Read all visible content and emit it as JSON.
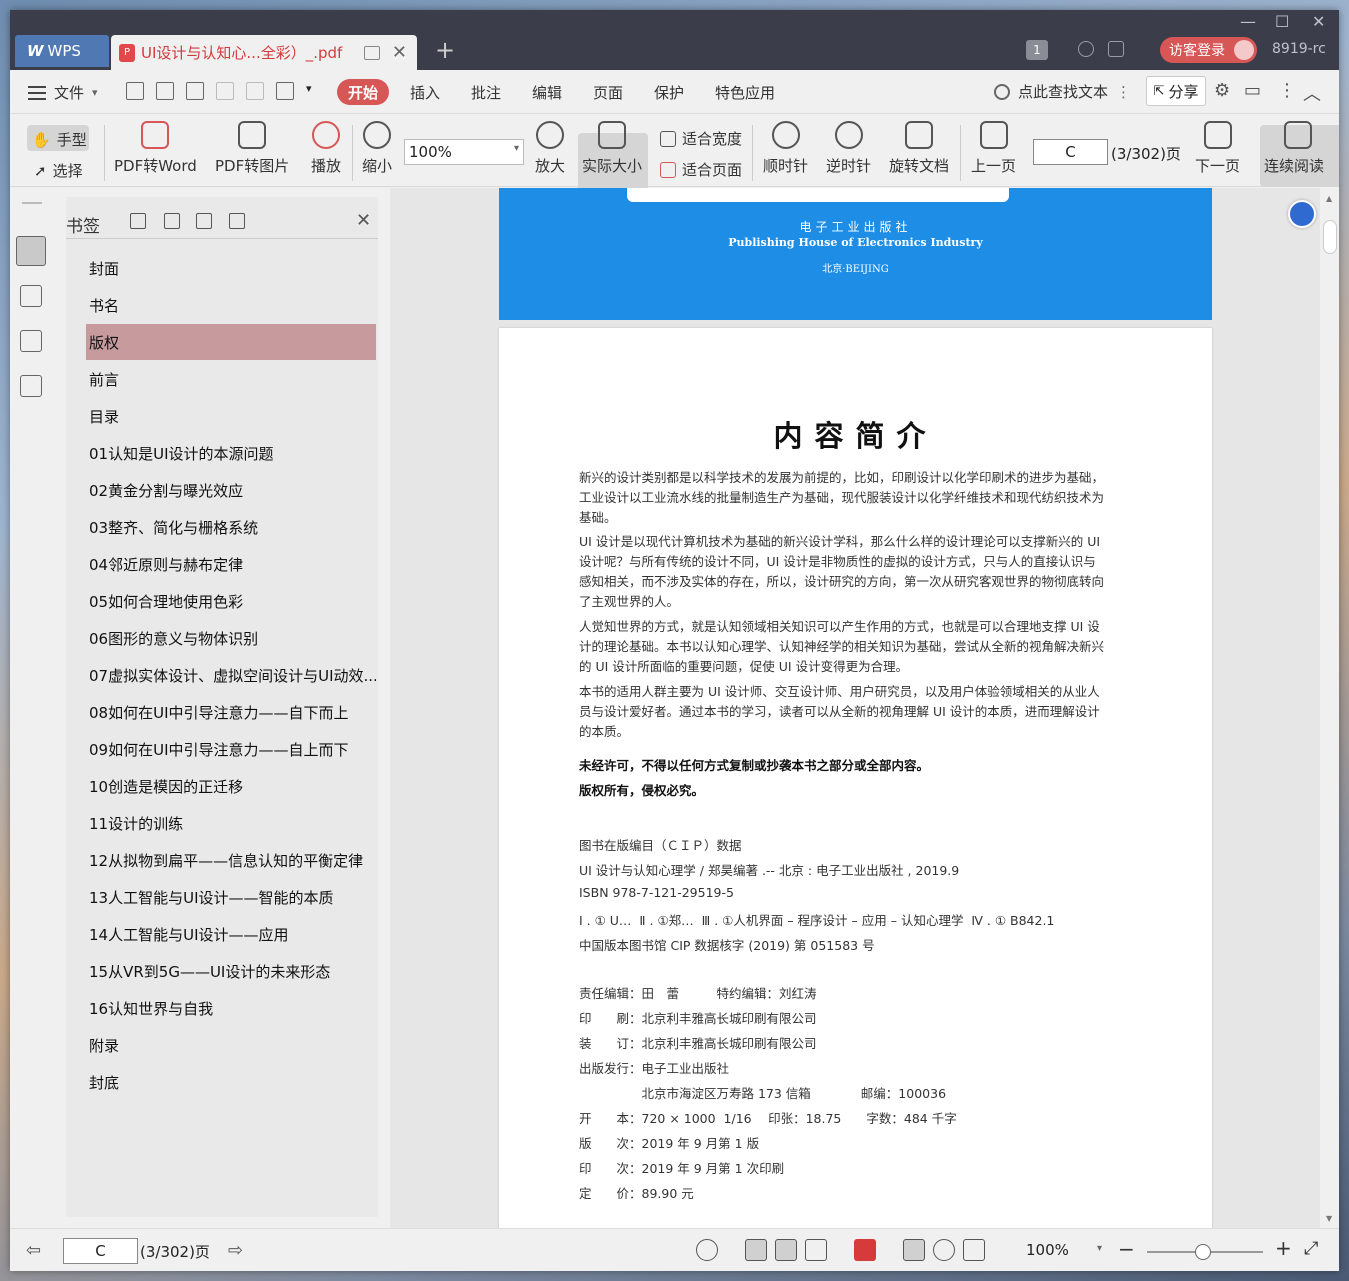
{
  "titlebar": {
    "app_tab": "WPS",
    "doc_tab": "UI设计与认知心...全彩）_.pdf",
    "badge": "1",
    "login": "访客登录",
    "user": "8919-rc",
    "win_min": "—",
    "win_max": "☐",
    "win_close": "✕"
  },
  "menubar": {
    "file": "文件",
    "tabs": [
      "开始",
      "插入",
      "批注",
      "编辑",
      "页面",
      "保护",
      "特色应用"
    ],
    "search": "点此查找文本",
    "share": "分享"
  },
  "ribbon": {
    "hand": "手型",
    "select": "选择",
    "pdf2word": "PDF转Word",
    "pdf2img": "PDF转图片",
    "play": "播放",
    "zoom_out": "缩小",
    "zoom_value": "100%",
    "zoom_in": "放大",
    "actual_size": "实际大小",
    "fit_width": "适合宽度",
    "fit_page": "适合页面",
    "clockwise": "顺时针",
    "counter_clockwise": "逆时针",
    "rotate_doc": "旋转文档",
    "prev_page": "上一页",
    "page_input": "C",
    "page_count": "(3/302)页",
    "next_page": "下一页",
    "continuous": "连续阅读"
  },
  "bookmarks": {
    "title": "书签",
    "items": [
      {
        "label": "封面",
        "expandable": false,
        "selected": false
      },
      {
        "label": "书名",
        "expandable": false,
        "selected": false
      },
      {
        "label": "版权",
        "expandable": false,
        "selected": true
      },
      {
        "label": "前言",
        "expandable": false,
        "selected": false
      },
      {
        "label": "目录",
        "expandable": false,
        "selected": false
      },
      {
        "label": "01认知是UI设计的本源问题",
        "expandable": true,
        "selected": false
      },
      {
        "label": "02黄金分割与曝光效应",
        "expandable": true,
        "selected": false
      },
      {
        "label": "03整齐、简化与栅格系统",
        "expandable": true,
        "selected": false
      },
      {
        "label": "04邻近原则与赫布定律",
        "expandable": true,
        "selected": false
      },
      {
        "label": "05如何合理地使用色彩",
        "expandable": true,
        "selected": false
      },
      {
        "label": "06图形的意义与物体识别",
        "expandable": true,
        "selected": false
      },
      {
        "label": "07虚拟实体设计、虚拟空间设计与UI动效...",
        "expandable": true,
        "selected": false
      },
      {
        "label": "08如何在UI中引导注意力——自下而上",
        "expandable": true,
        "selected": false
      },
      {
        "label": "09如何在UI中引导注意力——自上而下",
        "expandable": true,
        "selected": false
      },
      {
        "label": "10创造是模因的正迁移",
        "expandable": true,
        "selected": false
      },
      {
        "label": "11设计的训练",
        "expandable": true,
        "selected": false
      },
      {
        "label": "12从拟物到扁平——信息认知的平衡定律",
        "expandable": true,
        "selected": false
      },
      {
        "label": "13人工智能与UI设计——智能的本质",
        "expandable": true,
        "selected": false
      },
      {
        "label": "14人工智能与UI设计——应用",
        "expandable": true,
        "selected": false
      },
      {
        "label": "15从VR到5G——UI设计的未来形态",
        "expandable": true,
        "selected": false
      },
      {
        "label": "16认知世界与自我",
        "expandable": true,
        "selected": false
      },
      {
        "label": "附录",
        "expandable": false,
        "selected": false
      },
      {
        "label": "封底",
        "expandable": false,
        "selected": false
      }
    ]
  },
  "cover": {
    "line1": "电子工业出版社",
    "line2": "Publishing House of Electronics Industry",
    "line3": "北京·BEIJING"
  },
  "page": {
    "title": "内容简介",
    "paragraphs": [
      "新兴的设计类别都是以科学技术的发展为前提的，比如，印刷设计以化学印刷术的进步为基础，工业设计以工业流水线的批量制造生产为基础，现代服装设计以化学纤维技术和现代纺织技术为基础。",
      "UI 设计是以现代计算机技术为基础的新兴设计学科，那么什么样的设计理论可以支撑新兴的 UI 设计呢？与所有传统的设计不同，UI 设计是非物质性的虚拟的设计方式，只与人的直接认识与感知相关，而不涉及实体的存在，所以，设计研究的方向，第一次从研究客观世界的物彻底转向了主观世界的人。",
      "人觉知世界的方式，就是认知领域相关知识可以产生作用的方式，也就是可以合理地支撑 UI 设计的理论基础。本书以认知心理学、认知神经学的相关知识为基础，尝试从全新的视角解决新兴的 UI 设计所面临的重要问题，促使 UI 设计变得更为合理。",
      "本书的适用人群主要为 UI 设计师、交互设计师、用户研究员，以及用户体验领域相关的从业人员与设计爱好者。通过本书的学习，读者可以从全新的视角理解 UI 设计的本质，进而理解设计的本质。"
    ],
    "bold1": "未经许可，不得以任何方式复制或抄袭本书之部分或全部内容。",
    "bold2": "版权所有，侵权必究。",
    "cip": [
      "图书在版编目（ＣＩＰ）数据",
      "UI 设计与认知心理学 / 郑昊编著 .-- 北京 : 电子工业出版社 , 2019.9",
      "ISBN 978-7-121-29519-5",
      "Ⅰ . ① U…  Ⅱ . ①郑…  Ⅲ . ①人机界面 – 程序设计 – 应用 – 认知心理学  Ⅳ . ① B842.1",
      "中国版本图书馆 CIP 数据核字 (2019) 第 051583 号"
    ],
    "credits": [
      "责任编辑：田　蕾　　　特约编辑：刘红涛",
      "印　　刷：北京利丰雅高长城印刷有限公司",
      "装　　订：北京利丰雅高长城印刷有限公司",
      "出版发行：电子工业出版社",
      "　　　　　北京市海淀区万寿路 173 信箱　　　　邮编：100036",
      "开　　本：720 × 1000  1/16　 印张：18.75　　字数：484 千字",
      "版　　次：2019 年 9 月第 1 版",
      "印　　次：2019 年 9 月第 1 次印刷",
      "定　　价：89.90 元"
    ]
  },
  "status": {
    "page_input": "C",
    "page_count": "(3/302)页",
    "zoom": "100%"
  }
}
